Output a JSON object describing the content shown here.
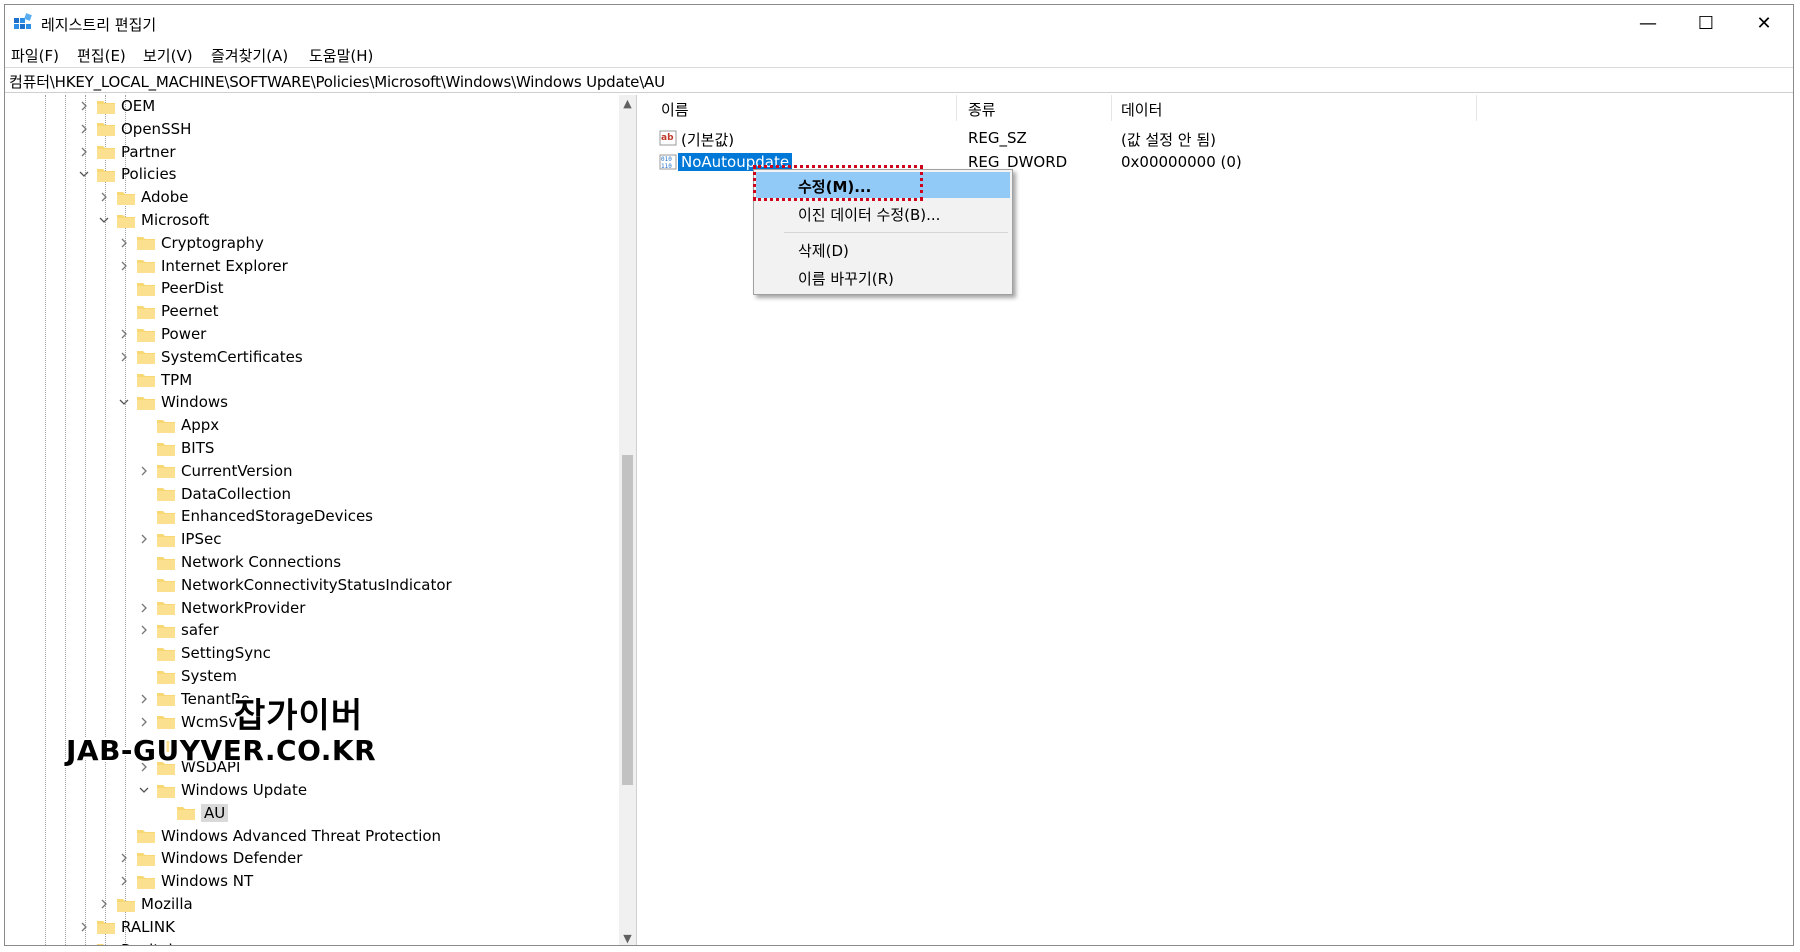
{
  "window": {
    "title": "레지스트리 편집기",
    "controls": {
      "minimize": "—",
      "maximize": "☐",
      "close": "✕"
    }
  },
  "menu": [
    "파일(F)",
    "편집(E)",
    "보기(V)",
    "즐겨찾기(A)",
    "도움말(H)"
  ],
  "address": "컴퓨터\\HKEY_LOCAL_MACHINE\\SOFTWARE\\Policies\\Microsoft\\Windows\\Windows Update\\AU",
  "tree": [
    {
      "label": "OEM",
      "level": 0,
      "exp": "closed"
    },
    {
      "label": "OpenSSH",
      "level": 0,
      "exp": "closed"
    },
    {
      "label": "Partner",
      "level": 0,
      "exp": "closed"
    },
    {
      "label": "Policies",
      "level": 0,
      "exp": "open"
    },
    {
      "label": "Adobe",
      "level": 1,
      "exp": "closed"
    },
    {
      "label": "Microsoft",
      "level": 1,
      "exp": "open"
    },
    {
      "label": "Cryptography",
      "level": 2,
      "exp": "closed"
    },
    {
      "label": "Internet Explorer",
      "level": 2,
      "exp": "closed"
    },
    {
      "label": "PeerDist",
      "level": 2,
      "exp": "none"
    },
    {
      "label": "Peernet",
      "level": 2,
      "exp": "none"
    },
    {
      "label": "Power",
      "level": 2,
      "exp": "closed"
    },
    {
      "label": "SystemCertificates",
      "level": 2,
      "exp": "closed"
    },
    {
      "label": "TPM",
      "level": 2,
      "exp": "none"
    },
    {
      "label": "Windows",
      "level": 2,
      "exp": "open"
    },
    {
      "label": "Appx",
      "level": 3,
      "exp": "none"
    },
    {
      "label": "BITS",
      "level": 3,
      "exp": "none"
    },
    {
      "label": "CurrentVersion",
      "level": 3,
      "exp": "closed"
    },
    {
      "label": "DataCollection",
      "level": 3,
      "exp": "none"
    },
    {
      "label": "EnhancedStorageDevices",
      "level": 3,
      "exp": "none"
    },
    {
      "label": "IPSec",
      "level": 3,
      "exp": "closed"
    },
    {
      "label": "Network Connections",
      "level": 3,
      "exp": "none"
    },
    {
      "label": "NetworkConnectivityStatusIndicator",
      "level": 3,
      "exp": "none"
    },
    {
      "label": "NetworkProvider",
      "level": 3,
      "exp": "closed"
    },
    {
      "label": "safer",
      "level": 3,
      "exp": "closed"
    },
    {
      "label": "SettingSync",
      "level": 3,
      "exp": "none"
    },
    {
      "label": "System",
      "level": 3,
      "exp": "none"
    },
    {
      "label": "TenantRe",
      "level": 3,
      "exp": "closed"
    },
    {
      "label": "WcmSvc",
      "level": 3,
      "exp": "closed"
    },
    {
      "label": "",
      "level": 3,
      "exp": "none"
    },
    {
      "label": "WSDAPI",
      "level": 3,
      "exp": "closed"
    },
    {
      "label": "Windows Update",
      "level": 3,
      "exp": "open"
    },
    {
      "label": "AU",
      "level": 4,
      "exp": "none",
      "selected": true
    },
    {
      "label": "Windows Advanced Threat Protection",
      "level": 2,
      "exp": "none"
    },
    {
      "label": "Windows Defender",
      "level": 2,
      "exp": "closed"
    },
    {
      "label": "Windows NT",
      "level": 2,
      "exp": "closed"
    },
    {
      "label": "Mozilla",
      "level": 1,
      "exp": "closed"
    },
    {
      "label": "RALINK",
      "level": 0,
      "exp": "closed"
    },
    {
      "label": "Realtek",
      "level": 0,
      "exp": "closed"
    }
  ],
  "list": {
    "headers": {
      "name": "이름",
      "type": "종류",
      "data": "데이터"
    },
    "rows": [
      {
        "icon": "string-value-icon",
        "name": "(기본값)",
        "type": "REG_SZ",
        "data": "(값 설정 안 됨)",
        "selected": false
      },
      {
        "icon": "dword-value-icon",
        "name": "NoAutoupdate",
        "type": "REG_DWORD",
        "data": "0x00000000 (0)",
        "selected": true
      }
    ]
  },
  "context_menu": {
    "modify": "수정(M)...",
    "modify_binary": "이진 데이터 수정(B)...",
    "delete": "삭제(D)",
    "rename": "이름 바꾸기(R)"
  },
  "watermark": {
    "line1": "잡가이버",
    "line2": "JAB-GUYVER.CO.KR"
  },
  "colors": {
    "selection": "#0078d7",
    "menu_highlight": "#91c9f7",
    "folder": "#f8d775",
    "annotation": "#d0021b"
  }
}
